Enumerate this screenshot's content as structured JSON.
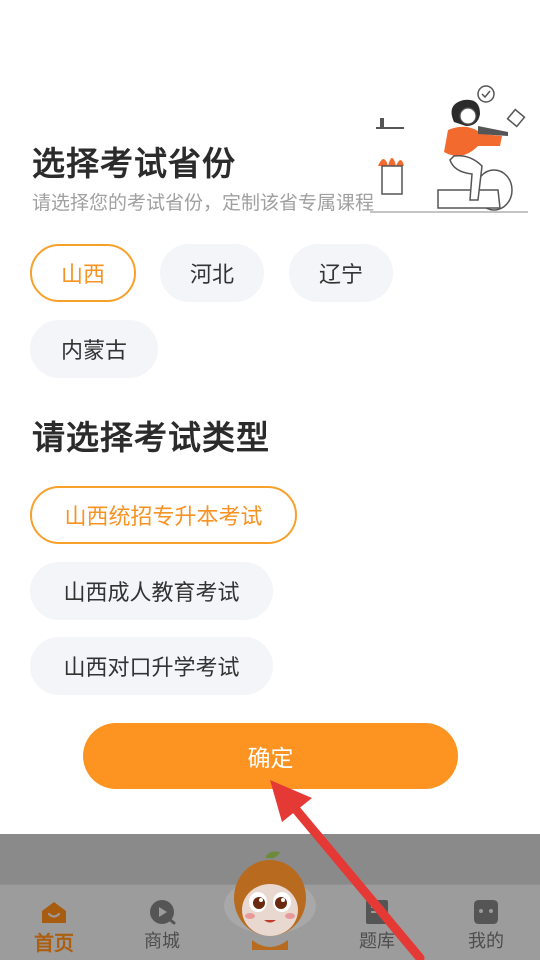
{
  "sheet": {
    "province_title": "选择考试省份",
    "province_subtitle": "请选择您的考试省份，定制该省专属课程",
    "provinces": [
      {
        "label": "山西",
        "selected": true
      },
      {
        "label": "河北",
        "selected": false
      },
      {
        "label": "辽宁",
        "selected": false
      },
      {
        "label": "内蒙古",
        "selected": false
      }
    ],
    "type_title": "请选择考试类型",
    "exam_types": [
      {
        "label": "山西统招专升本考试",
        "selected": true
      },
      {
        "label": "山西成人教育考试",
        "selected": false
      },
      {
        "label": "山西对口升学考试",
        "selected": false
      }
    ],
    "confirm_label": "确定"
  },
  "tabbar": {
    "items": [
      {
        "label": "首页",
        "icon": "home-icon",
        "active": true
      },
      {
        "label": "商城",
        "icon": "play-icon",
        "active": false
      },
      {
        "label": "题库",
        "icon": "question-bank-icon",
        "active": false
      },
      {
        "label": "我的",
        "icon": "profile-icon",
        "active": false
      }
    ]
  },
  "colors": {
    "accent": "#fd9421",
    "selected_border": "#f7a12b",
    "pill_bg": "#f4f5f9",
    "annotation_arrow": "#e53935"
  }
}
